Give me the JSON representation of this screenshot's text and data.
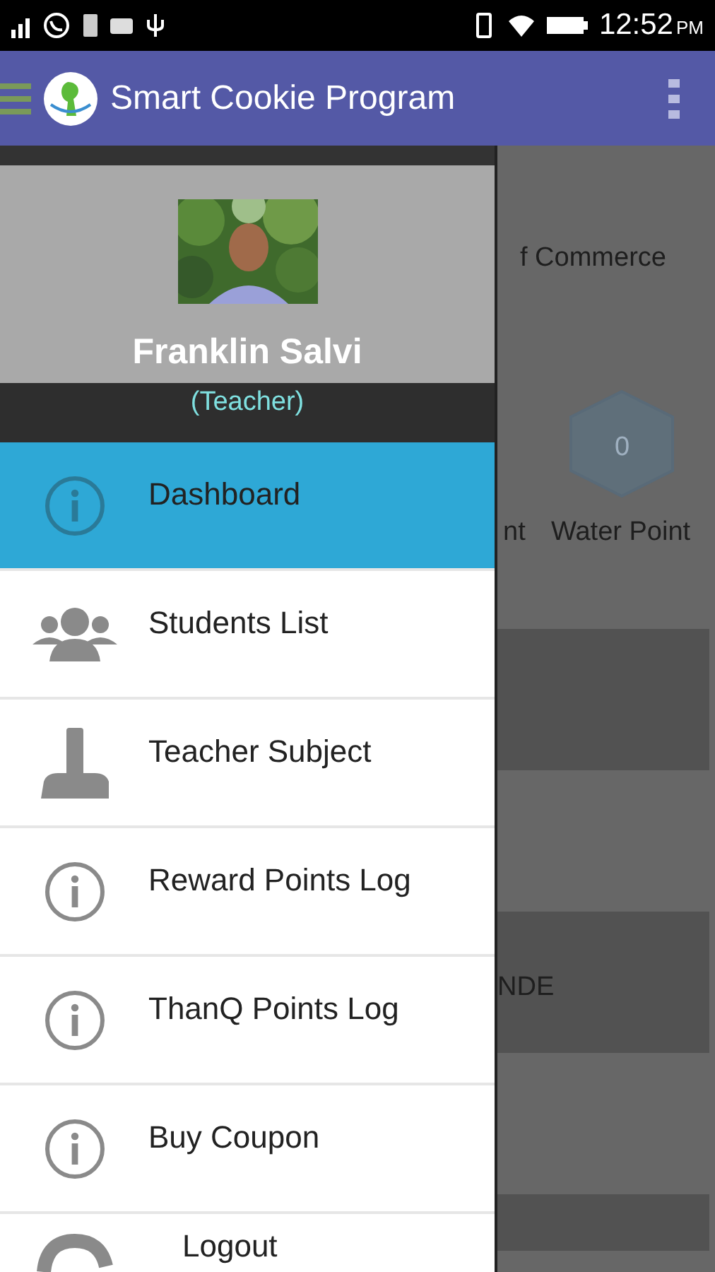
{
  "status_bar": {
    "time": "12:52",
    "meridiem": "PM"
  },
  "app_bar": {
    "title": "Smart Cookie Program"
  },
  "background": {
    "texts": [
      {
        "kind": "heading",
        "text": "f Commerce"
      },
      {
        "kind": "badge",
        "text": "0"
      },
      {
        "kind": "label-left",
        "text": "nt"
      },
      {
        "kind": "label-right",
        "text": "Water Point"
      },
      {
        "kind": "card",
        "text": "NDE"
      }
    ]
  },
  "drawer": {
    "user_name": "Franklin Salvi",
    "role": "(Teacher)",
    "items": [
      {
        "label": "Dashboard",
        "kind": "info",
        "selected": true
      },
      {
        "label": "Students List",
        "kind": "group",
        "selected": false
      },
      {
        "label": "Teacher Subject",
        "kind": "joystick",
        "selected": false
      },
      {
        "label": "Reward Points Log",
        "kind": "info",
        "selected": false
      },
      {
        "label": "ThanQ Points Log",
        "kind": "info",
        "selected": false
      },
      {
        "label": "Buy Coupon",
        "kind": "info",
        "selected": false
      },
      {
        "label": "Logout",
        "kind": "logout",
        "selected": false
      }
    ]
  }
}
